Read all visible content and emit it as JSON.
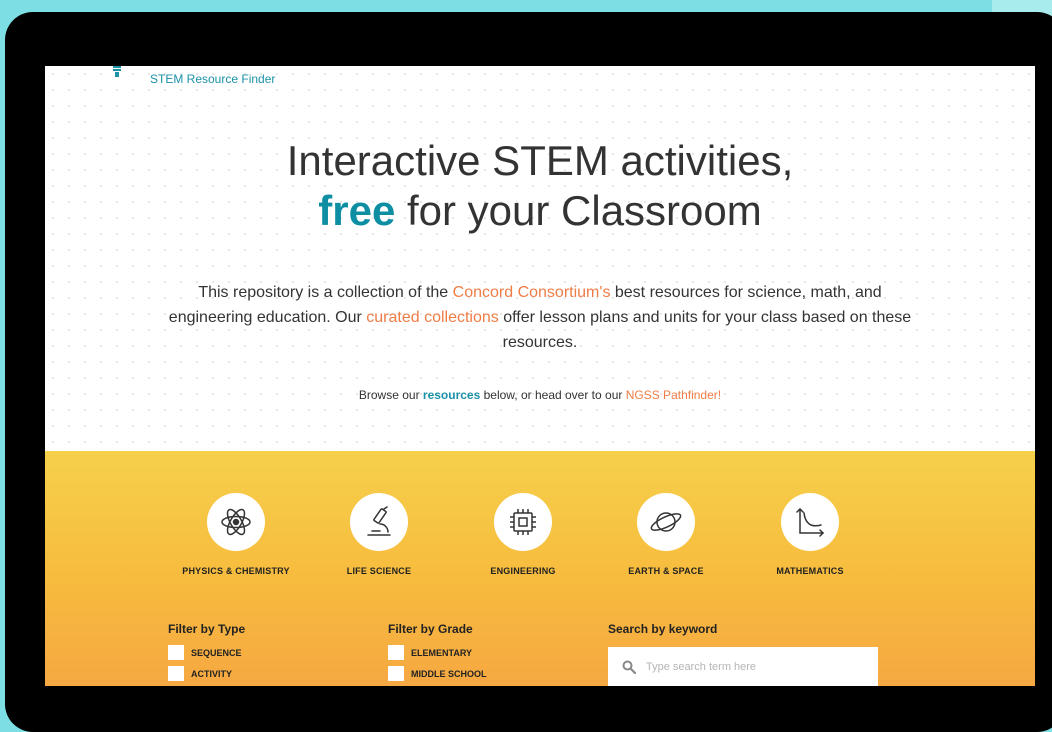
{
  "brand": {
    "name": "STEM Resource Finder",
    "icon": "stem-logo-icon"
  },
  "headline": {
    "line1": "Interactive STEM activities,",
    "accent": "free",
    "line2_rest": "for your Classroom"
  },
  "intro": {
    "part1": "This repository is a collection of the ",
    "link1": "Concord Consortium's",
    "part2": " best resources for science, math, and engineering education. Our ",
    "link2": "curated collections",
    "part3": " offer lesson plans and units for your class based on these resources."
  },
  "browse": {
    "part1": "Browse our ",
    "link1": "resources",
    "part2": " below, or head over to our ",
    "link2": "NGSS Pathfinder!"
  },
  "categories": [
    {
      "label": "PHYSICS & CHEMISTRY",
      "icon": "atom-icon"
    },
    {
      "label": "LIFE SCIENCE",
      "icon": "microscope-icon"
    },
    {
      "label": "ENGINEERING",
      "icon": "chip-icon"
    },
    {
      "label": "EARTH & SPACE",
      "icon": "planet-icon"
    },
    {
      "label": "MATHEMATICS",
      "icon": "graph-icon"
    }
  ],
  "filters": {
    "type": {
      "title": "Filter by Type",
      "options": [
        "SEQUENCE",
        "ACTIVITY"
      ]
    },
    "grade": {
      "title": "Filter by Grade",
      "options": [
        "ELEMENTARY",
        "MIDDLE SCHOOL"
      ]
    }
  },
  "search": {
    "title": "Search by keyword",
    "placeholder": "Type search term here",
    "icon": "search-icon"
  },
  "colors": {
    "accent_teal": "#0e8ea3",
    "link_orange": "#ef7d45",
    "panel_top": "#f6d04a",
    "panel_bottom": "#f6a842",
    "device_frame": "#000000",
    "background": "#7ddfe3"
  }
}
